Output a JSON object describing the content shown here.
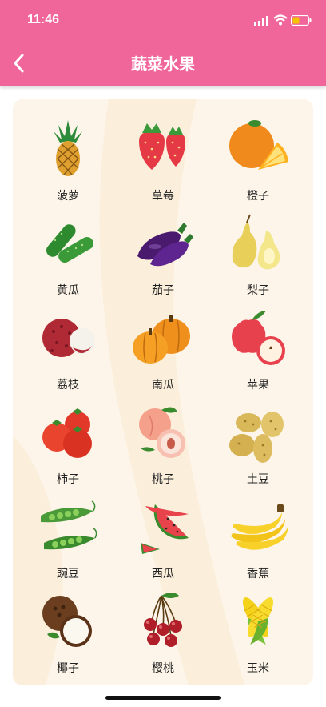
{
  "status_bar": {
    "time": "11:46"
  },
  "header": {
    "title": "蔬菜水果",
    "back_icon": "chevron-left-icon"
  },
  "items": [
    {
      "label": "菠萝",
      "icon": "pineapple-icon"
    },
    {
      "label": "草莓",
      "icon": "strawberry-icon"
    },
    {
      "label": "橙子",
      "icon": "orange-icon"
    },
    {
      "label": "黄瓜",
      "icon": "cucumber-icon"
    },
    {
      "label": "茄子",
      "icon": "eggplant-icon"
    },
    {
      "label": "梨子",
      "icon": "pear-icon"
    },
    {
      "label": "荔枝",
      "icon": "lychee-icon"
    },
    {
      "label": "南瓜",
      "icon": "pumpkin-icon"
    },
    {
      "label": "苹果",
      "icon": "apple-icon"
    },
    {
      "label": "柿子",
      "icon": "persimmon-icon"
    },
    {
      "label": "桃子",
      "icon": "peach-icon"
    },
    {
      "label": "土豆",
      "icon": "potato-icon"
    },
    {
      "label": "豌豆",
      "icon": "peas-icon"
    },
    {
      "label": "西瓜",
      "icon": "watermelon-icon"
    },
    {
      "label": "香蕉",
      "icon": "banana-icon"
    },
    {
      "label": "椰子",
      "icon": "coconut-icon"
    },
    {
      "label": "樱桃",
      "icon": "cherry-icon"
    },
    {
      "label": "玉米",
      "icon": "corn-icon"
    }
  ],
  "colors": {
    "header": "#f0669a",
    "card": "#fdf5e9",
    "battery": "#f5c400"
  }
}
